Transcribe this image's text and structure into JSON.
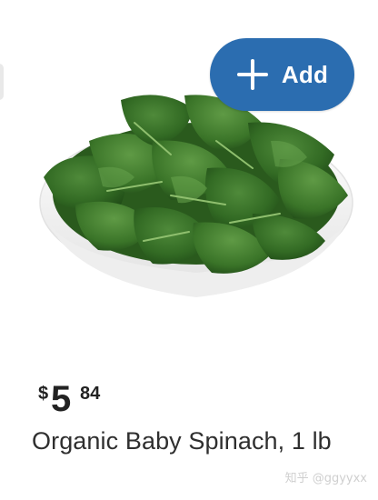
{
  "add_button": {
    "label": "Add",
    "icon": "plus-icon",
    "color": "#2b6db0"
  },
  "product": {
    "image_alt": "spinach-bowl-image",
    "price": {
      "currency_symbol": "$",
      "dollars": "5",
      "cents": "84"
    },
    "title": "Organic Baby Spinach, 1 lb"
  },
  "watermark": "知乎 @ggyyxx"
}
